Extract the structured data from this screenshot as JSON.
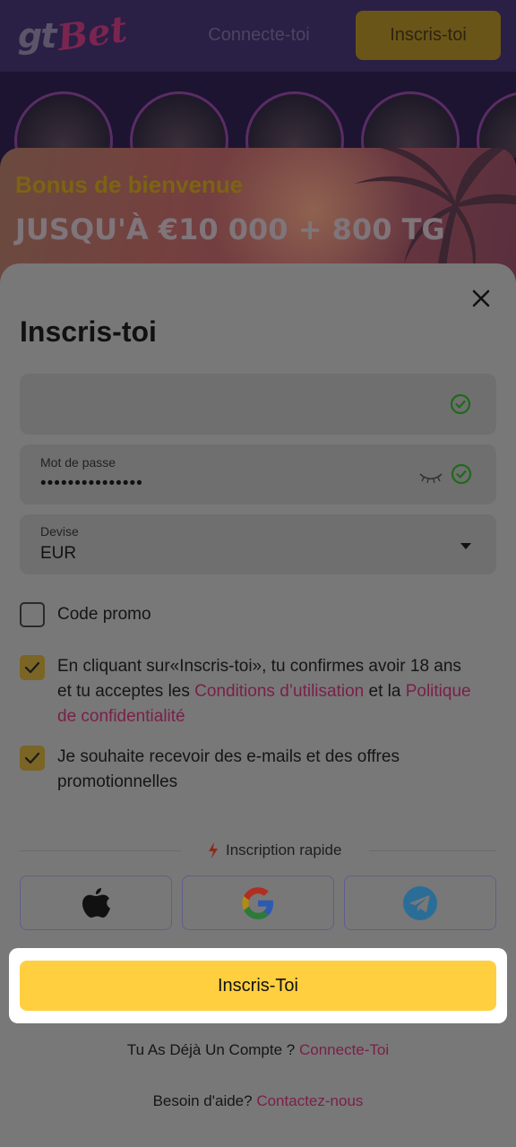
{
  "app": {
    "logo_text_1": "gt",
    "logo_text_2": "Bet"
  },
  "topbar": {
    "login_label": "Connecte-toi",
    "signup_label": "Inscris-toi"
  },
  "banner": {
    "title": "Bonus de bienvenue",
    "amount": "JUSQU'À €10 000 + 800 TG"
  },
  "form": {
    "heading": "Inscris-toi",
    "email": {
      "value": ""
    },
    "password": {
      "label": "Mot de passe",
      "value": "•••••••••••••••"
    },
    "currency": {
      "label": "Devise",
      "value": "EUR"
    },
    "promo": {
      "label": "Code promo",
      "checked": false
    },
    "terms": {
      "checked": true,
      "text_1": "En cliquant sur«Inscris-toi», tu confirmes avoir 18 ans et tu acceptes les ",
      "link_1": "Conditions d’utilisation",
      "text_2": " et la ",
      "link_2": "Politique de confidentialité"
    },
    "marketing": {
      "checked": true,
      "text": "Je souhaite recevoir des e-mails et des offres promotionnelles"
    }
  },
  "quick_signup": {
    "label": "Inscription rapide",
    "providers": [
      "apple-icon",
      "google-icon",
      "telegram-icon"
    ]
  },
  "cta": {
    "label": "Inscris-Toi"
  },
  "footer": {
    "have_account": "Tu As Déjà Un Compte ? ",
    "login_link": "Connecte-Toi",
    "help_text": "Besoin d'aide? ",
    "contact_link": "Contactez-nous"
  },
  "colors": {
    "accent_yellow": "#ffcf40",
    "link_pink": "#7a1f48",
    "success_green": "#1f6a1a"
  }
}
